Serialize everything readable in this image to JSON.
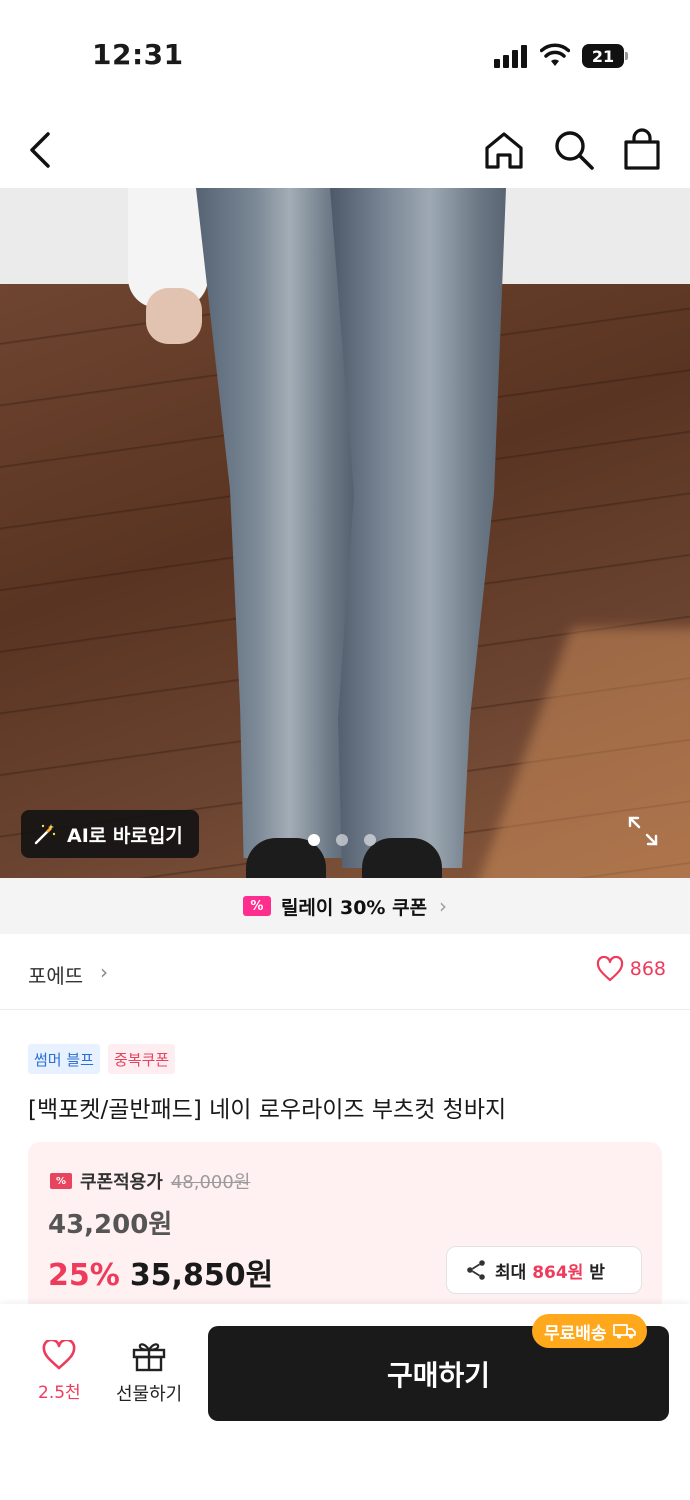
{
  "status_bar": {
    "time": "12:31",
    "battery": "21"
  },
  "header": {
    "back_icon": "chevron-left-icon",
    "home_icon": "home-icon",
    "search_icon": "search-icon",
    "cart_icon": "shopping-bag-icon"
  },
  "gallery": {
    "ai_button_label": "AI로 바로입기",
    "dots_total": 3,
    "active_dot": 1
  },
  "relay_coupon": {
    "label": "릴레이 30% 쿠폰",
    "badge": "%"
  },
  "store": {
    "name": "포에뜨",
    "likes": "868"
  },
  "badges": [
    {
      "label": "썸머 블프"
    },
    {
      "label": "중복쿠폰"
    }
  ],
  "product": {
    "title": "[백포켓/골반패드] 네이 로우라이즈 부츠컷 청바지"
  },
  "price": {
    "coupon_label": "쿠폰적용가",
    "original_price": "48,000원",
    "sale_price": "43,200원",
    "discount": "25%",
    "final_price": "35,850원",
    "share_prefix": "최대 ",
    "share_amount": "864원",
    "share_suffix": " 받"
  },
  "bottom_bar": {
    "like_count": "2.5천",
    "gift_label": "선물하기",
    "buy_label": "구매하기",
    "free_shipping_label": "무료배송"
  },
  "colors": {
    "accent_pink": "#ee3b5b",
    "relay_pink": "#ff2d8e",
    "free_ship_orange": "#ffa81c",
    "buy_dark": "#1a1a1a"
  }
}
